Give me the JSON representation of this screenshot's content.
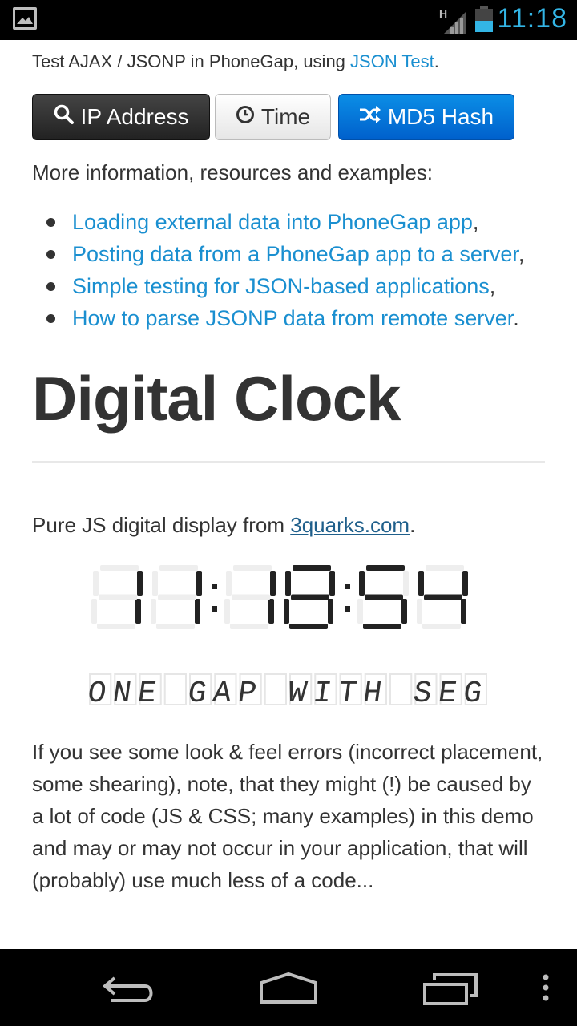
{
  "status_bar": {
    "time": "11:18",
    "network_type": "H",
    "accent_color": "#33b5e5"
  },
  "intro": {
    "prefix": "Test AJAX / JSONP in PhoneGap, using ",
    "link": "JSON Test",
    "suffix": "."
  },
  "buttons": [
    {
      "label": "IP Address",
      "icon": "search-icon"
    },
    {
      "label": "Time",
      "icon": "clock-icon"
    },
    {
      "label": "MD5 Hash",
      "icon": "shuffle-icon"
    }
  ],
  "more_info": "More information, resources and examples:",
  "resource_links": [
    {
      "text": "Loading external data into PhoneGap app",
      "punct": ","
    },
    {
      "text": "Posting data from a PhoneGap app to a server",
      "punct": ","
    },
    {
      "text": "Simple testing for JSON-based applications",
      "punct": ","
    },
    {
      "text": "How to parse JSONP data from remote server",
      "punct": "."
    }
  ],
  "heading": "Digital Clock",
  "pure_js": {
    "prefix": "Pure JS digital display from ",
    "link": "3quarks.com",
    "suffix": "."
  },
  "clock_display": "11:18:54",
  "segment_display": "ONE GAP WITH SEG",
  "paragraph": "If you see some look & feel errors (incorrect placement, some shearing), note, that they might (!) be caused by a lot of code (JS & CSS; many examples) in this demo and may or may not occur in your application, that will (probably) use much less of a code..."
}
